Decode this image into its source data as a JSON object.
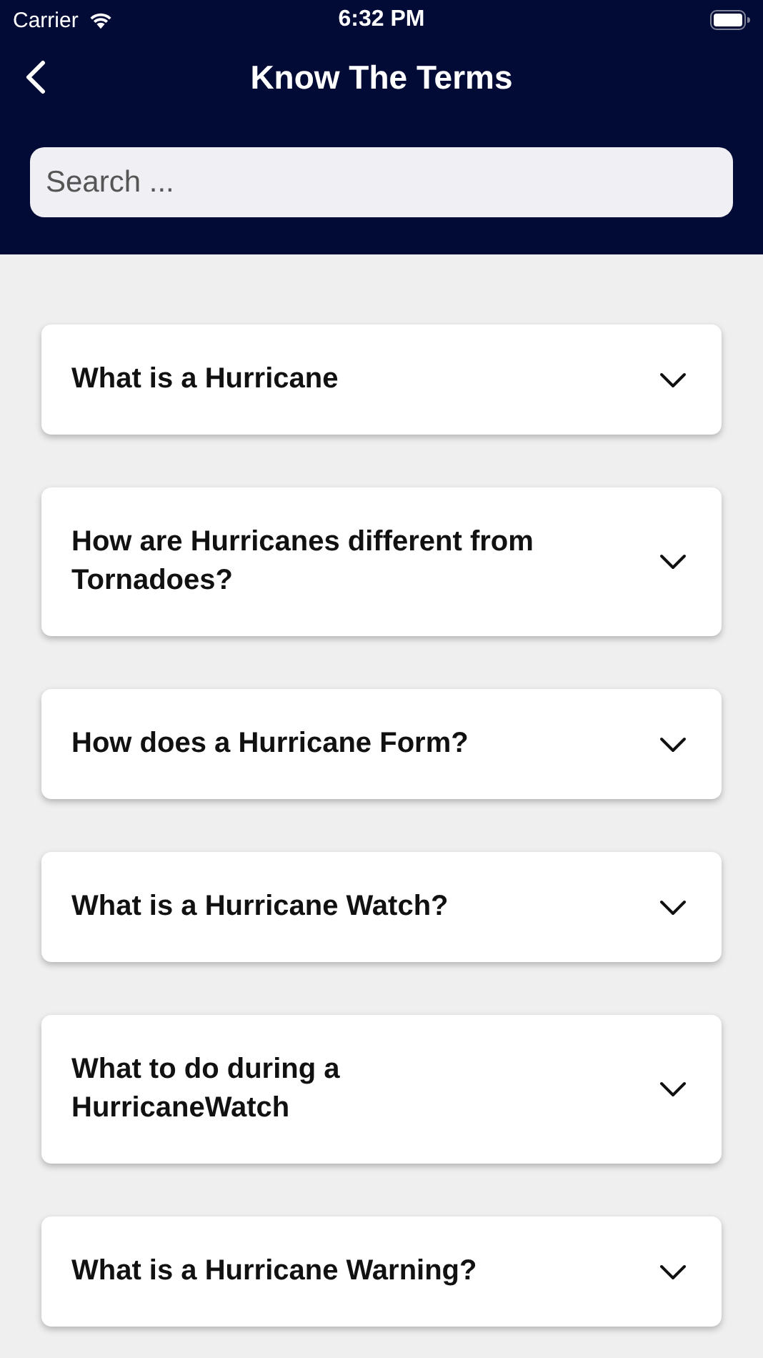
{
  "status_bar": {
    "carrier": "Carrier",
    "time": "6:32 PM"
  },
  "nav": {
    "title": "Know The Terms"
  },
  "search": {
    "placeholder": "Search ..."
  },
  "questions": [
    {
      "text": "What is a Hurricane",
      "expanded": false
    },
    {
      "text": "How are Hurricanes different from Tornadoes?",
      "expanded": false
    },
    {
      "text": "How does a Hurricane Form?",
      "expanded": false
    },
    {
      "text": "What is a Hurricane Watch?",
      "expanded": false
    },
    {
      "text": "What to do during a HurricaneWatch",
      "expanded": false
    },
    {
      "text": "What is a Hurricane Warning?",
      "expanded": false
    }
  ]
}
